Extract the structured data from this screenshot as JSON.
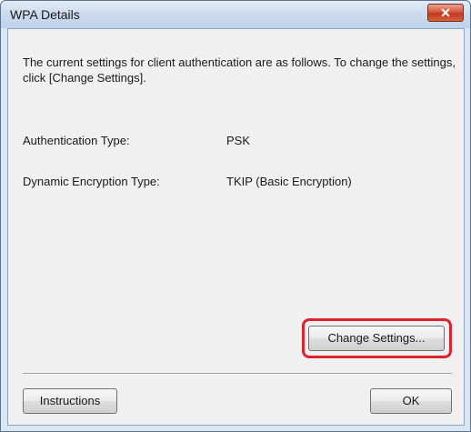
{
  "window": {
    "title": "WPA Details",
    "close_label": "✕"
  },
  "description": "The current settings for client authentication are as follows. To change the settings, click [Change Settings].",
  "fields": [
    {
      "label": "Authentication Type:",
      "value": "PSK"
    },
    {
      "label": "Dynamic Encryption Type:",
      "value": "TKIP (Basic Encryption)"
    }
  ],
  "buttons": {
    "change_settings": "Change Settings...",
    "instructions": "Instructions",
    "ok": "OK"
  },
  "colors": {
    "highlight": "#e0212e",
    "title_bar": "#c0d2e9"
  }
}
